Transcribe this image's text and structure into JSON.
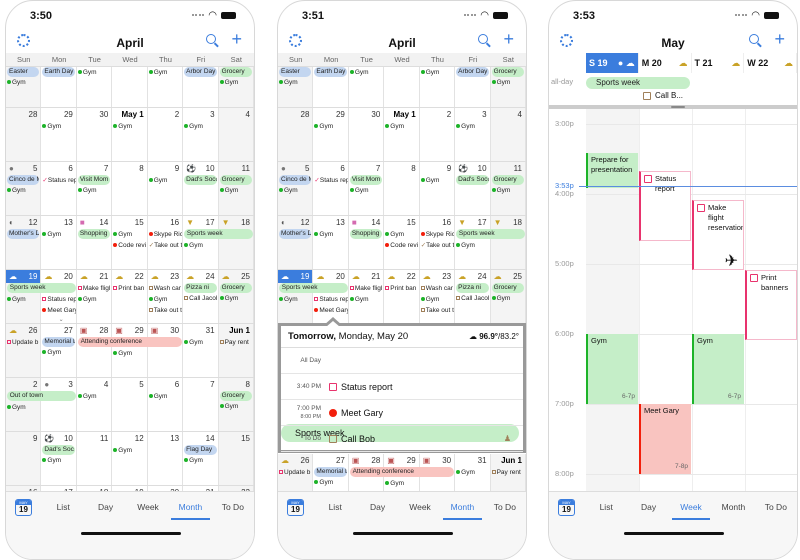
{
  "colors": {
    "accent": "#3b7ddd",
    "green_bar": "#c5eec8",
    "blue_bar": "#c3d6f0",
    "red_bar": "#f9c4c0",
    "green_dot": "#1db329",
    "red_dot": "#f21f0c",
    "pink_task": "#e8336d",
    "brown_task": "#a0805a"
  },
  "phones": [
    {
      "status_time": "3:50",
      "title": "April",
      "selected_tab": "Month"
    },
    {
      "status_time": "3:51",
      "title": "April",
      "selected_tab": "Month"
    },
    {
      "status_time": "3:53",
      "title": "May",
      "selected_tab": "Week"
    }
  ],
  "weekdays": [
    "Sun",
    "Mon",
    "Tue",
    "Wed",
    "Thu",
    "Fri",
    "Sat"
  ],
  "tabs": [
    "List",
    "Day",
    "Week",
    "Month",
    "To Do"
  ],
  "today_badge": {
    "month": "MAY",
    "day": "19"
  },
  "month_weeks": [
    {
      "days": [
        {
          "num": "",
          "events": [
            {
              "t": "bar",
              "c": "blue",
              "text": "Easter"
            },
            {
              "t": "dot",
              "c": "green",
              "text": "Gym"
            }
          ]
        },
        {
          "num": "",
          "events": [
            {
              "t": "bar",
              "c": "blue",
              "text": "Earth Day"
            }
          ]
        },
        {
          "num": "",
          "events": [
            {
              "t": "dot",
              "c": "green",
              "text": "Gym"
            }
          ]
        },
        {
          "num": "",
          "events": []
        },
        {
          "num": "",
          "events": [
            {
              "t": "dot",
              "c": "green",
              "text": "Gym"
            }
          ]
        },
        {
          "num": "",
          "events": [
            {
              "t": "bar",
              "c": "blue",
              "text": "Arbor Day"
            }
          ]
        },
        {
          "num": "",
          "events": [
            {
              "t": "bar",
              "c": "green",
              "text": "Grocery"
            },
            {
              "t": "dot",
              "c": "green",
              "text": "Gym"
            }
          ]
        }
      ],
      "spans": []
    },
    {
      "days": [
        {
          "num": "28",
          "events": []
        },
        {
          "num": "29",
          "events": [
            {
              "t": "dot",
              "c": "green",
              "text": "Gym"
            }
          ]
        },
        {
          "num": "30",
          "events": []
        },
        {
          "num": "May 1",
          "bold": true,
          "events": [
            {
              "t": "dot",
              "c": "green",
              "text": "Gym"
            }
          ]
        },
        {
          "num": "2",
          "events": []
        },
        {
          "num": "3",
          "events": [
            {
              "t": "dot",
              "c": "green",
              "text": "Gym"
            }
          ]
        },
        {
          "num": "4",
          "events": []
        }
      ],
      "spans": []
    },
    {
      "days": [
        {
          "num": "5",
          "icon": "moon-full",
          "events": [
            {
              "t": "bar",
              "c": "blue",
              "text": "Cinco de M"
            },
            {
              "t": "dot",
              "c": "green",
              "text": "Gym"
            }
          ]
        },
        {
          "num": "6",
          "events": [
            {
              "t": "check",
              "c": "pink",
              "text": "Status rep"
            }
          ]
        },
        {
          "num": "7",
          "events": [
            {
              "t": "bar",
              "c": "green",
              "text": "Visit Mom"
            },
            {
              "t": "dot",
              "c": "green",
              "text": "Gym"
            }
          ]
        },
        {
          "num": "8",
          "events": []
        },
        {
          "num": "9",
          "events": [
            {
              "t": "dot",
              "c": "green",
              "text": "Gym"
            }
          ]
        },
        {
          "num": "10",
          "icon": "soccer",
          "events": [
            {
              "t": "bar",
              "c": "green",
              "text": "Dad's Socc"
            }
          ]
        },
        {
          "num": "11",
          "events": [
            {
              "t": "bar",
              "c": "green",
              "text": "Grocery"
            },
            {
              "t": "dot",
              "c": "green",
              "text": "Gym"
            }
          ]
        }
      ],
      "spans": []
    },
    {
      "days": [
        {
          "num": "12",
          "icon": "moon-half",
          "events": [
            {
              "t": "bar",
              "c": "blue",
              "text": "Mother's D"
            }
          ]
        },
        {
          "num": "13",
          "events": [
            {
              "t": "dot",
              "c": "green",
              "text": "Gym"
            }
          ]
        },
        {
          "num": "14",
          "icon": "shopping-bag",
          "events": [
            {
              "t": "bar",
              "c": "green",
              "text": "Shopping"
            }
          ]
        },
        {
          "num": "15",
          "events": [
            {
              "t": "dot",
              "c": "green",
              "text": "Gym"
            },
            {
              "t": "dot",
              "c": "red",
              "text": "Code revi"
            }
          ]
        },
        {
          "num": "16",
          "events": [
            {
              "t": "dot",
              "c": "red",
              "text": "Skype Ric"
            },
            {
              "t": "check",
              "c": "brown",
              "text": "Take out t"
            }
          ]
        },
        {
          "num": "17",
          "icon": "trophy",
          "events": [
            {
              "t": "gap"
            },
            {
              "t": "dot",
              "c": "green",
              "text": "Gym"
            }
          ]
        },
        {
          "num": "18",
          "icon": "trophy",
          "events": [
            {
              "t": "gap"
            }
          ]
        }
      ],
      "spans": [
        {
          "start": 5,
          "days": 2,
          "c": "green",
          "text": "Sports week"
        }
      ]
    },
    {
      "days": [
        {
          "num": "19",
          "today": true,
          "icon": "weather",
          "events": [
            {
              "t": "gap"
            },
            {
              "t": "dot",
              "c": "green",
              "text": "Gym"
            }
          ]
        },
        {
          "num": "20",
          "icon": "weather",
          "chevron": true,
          "events": [
            {
              "t": "gap"
            },
            {
              "t": "box",
              "c": "pink",
              "text": "Status rep"
            },
            {
              "t": "dot",
              "c": "red",
              "text": "Meet Gary"
            }
          ]
        },
        {
          "num": "21",
          "icon": "weather",
          "events": [
            {
              "t": "box",
              "c": "pink",
              "text": "Make fligl"
            },
            {
              "t": "dot",
              "c": "green",
              "text": "Gym"
            }
          ]
        },
        {
          "num": "22",
          "icon": "weather",
          "events": [
            {
              "t": "box",
              "c": "pink",
              "text": "Print ban"
            }
          ]
        },
        {
          "num": "23",
          "icon": "weather",
          "events": [
            {
              "t": "box",
              "c": "brown",
              "text": "Wash car"
            },
            {
              "t": "dot",
              "c": "green",
              "text": "Gym"
            },
            {
              "t": "box",
              "c": "brown",
              "text": "Take out t"
            }
          ]
        },
        {
          "num": "24",
          "icon": "weather",
          "events": [
            {
              "t": "bar",
              "c": "green",
              "text": "Pizza ni"
            },
            {
              "t": "box",
              "c": "brown",
              "text": "Call Jacol"
            }
          ]
        },
        {
          "num": "25",
          "icon": "weather",
          "events": [
            {
              "t": "bar",
              "c": "green",
              "text": "Grocery"
            },
            {
              "t": "dot",
              "c": "green",
              "text": "Gym"
            }
          ]
        }
      ],
      "spans": [
        {
          "start": 0,
          "days": 2,
          "c": "green",
          "text": "Sports week"
        }
      ]
    },
    {
      "days": [
        {
          "num": "26",
          "icon": "weather",
          "events": [
            {
              "t": "box",
              "c": "pink",
              "text": "Update b"
            }
          ]
        },
        {
          "num": "27",
          "events": [
            {
              "t": "bar",
              "c": "blue",
              "text": "Memorial D"
            },
            {
              "t": "dot",
              "c": "green",
              "text": "Gym"
            }
          ]
        },
        {
          "num": "28",
          "icon": "conference",
          "events": [
            {
              "t": "gap"
            }
          ]
        },
        {
          "num": "29",
          "icon": "conference",
          "events": [
            {
              "t": "gap"
            },
            {
              "t": "dot",
              "c": "green",
              "text": "Gym"
            }
          ]
        },
        {
          "num": "30",
          "icon": "conference",
          "events": [
            {
              "t": "gap"
            }
          ]
        },
        {
          "num": "31",
          "events": [
            {
              "t": "dot",
              "c": "green",
              "text": "Gym"
            }
          ]
        },
        {
          "num": "Jun 1",
          "bold": true,
          "events": [
            {
              "t": "box",
              "c": "brown",
              "text": "Pay rent"
            }
          ]
        }
      ],
      "spans": [
        {
          "start": 2,
          "days": 3,
          "c": "red",
          "text": "Attending conference"
        }
      ]
    },
    {
      "days": [
        {
          "num": "2",
          "events": [
            {
              "t": "gap"
            },
            {
              "t": "dot",
              "c": "green",
              "text": "Gym"
            }
          ]
        },
        {
          "num": "3",
          "icon": "moon-new",
          "events": [
            {
              "t": "gap"
            }
          ]
        },
        {
          "num": "4",
          "events": [
            {
              "t": "dot",
              "c": "green",
              "text": "Gym"
            }
          ]
        },
        {
          "num": "5",
          "events": []
        },
        {
          "num": "6",
          "events": [
            {
              "t": "dot",
              "c": "green",
              "text": "Gym"
            }
          ]
        },
        {
          "num": "7",
          "events": []
        },
        {
          "num": "8",
          "events": [
            {
              "t": "bar",
              "c": "green",
              "text": "Grocery"
            },
            {
              "t": "dot",
              "c": "green",
              "text": "Gym"
            }
          ]
        }
      ],
      "spans": [
        {
          "start": 0,
          "days": 2,
          "c": "green",
          "text": "Out of town"
        }
      ]
    },
    {
      "days": [
        {
          "num": "9",
          "events": []
        },
        {
          "num": "10",
          "icon": "soccer",
          "events": [
            {
              "t": "bar",
              "c": "green",
              "text": "Dad's Soc"
            },
            {
              "t": "dot",
              "c": "green",
              "text": "Gym"
            }
          ]
        },
        {
          "num": "11",
          "events": []
        },
        {
          "num": "12",
          "events": [
            {
              "t": "dot",
              "c": "green",
              "text": "Gym"
            }
          ]
        },
        {
          "num": "13",
          "events": []
        },
        {
          "num": "14",
          "events": [
            {
              "t": "bar",
              "c": "blue",
              "text": "Flag Day"
            },
            {
              "t": "dot",
              "c": "green",
              "text": "Gym"
            }
          ]
        },
        {
          "num": "15",
          "events": []
        }
      ],
      "spans": []
    },
    {
      "days": [
        {
          "num": "16",
          "events": []
        },
        {
          "num": "17",
          "icon": "moon-empty",
          "events": []
        },
        {
          "num": "18",
          "events": []
        },
        {
          "num": "19",
          "events": []
        },
        {
          "num": "20",
          "events": []
        },
        {
          "num": "21",
          "events": []
        },
        {
          "num": "22",
          "events": []
        }
      ],
      "spans": []
    }
  ],
  "popup": {
    "title_bold": "Tomorrow,",
    "title_rest": " Monday, May 20",
    "weather_high": "96.9°",
    "weather_low": "/83.2°",
    "rows": [
      {
        "label": "All Day",
        "label2": "",
        "text": "Sports week",
        "kind": "allday"
      },
      {
        "label": "3:40 PM",
        "label2": "",
        "text": "Status report",
        "kind": "task-pink"
      },
      {
        "label": "7:00 PM",
        "label2": "8:00 PM",
        "text": "Meet Gary",
        "kind": "event-red"
      },
      {
        "label": "To Do",
        "label2": "",
        "text": "Call Bob",
        "kind": "task-brown"
      }
    ]
  },
  "week_view": {
    "days": [
      {
        "label": "S 19",
        "today": true
      },
      {
        "label": "M 20"
      },
      {
        "label": "T 21"
      },
      {
        "label": "W 22"
      }
    ],
    "allday_label": "all-day",
    "allday_span": {
      "text": "Sports week",
      "start": 0,
      "days": 2
    },
    "allday_todo": {
      "text": "Call B...",
      "day": 1
    },
    "hours": [
      "3:00p",
      "4:00p",
      "5:00p",
      "6:00p",
      "7:00p",
      "8:00p"
    ],
    "now_label": "3:53p",
    "now": "15:53",
    "events": [
      {
        "day": 0,
        "start": "15:25",
        "end": "15:55",
        "text": "Prepare for presentation",
        "kind": "event-green"
      },
      {
        "day": 1,
        "start": "15:40",
        "end": "16:40",
        "text": "Status report",
        "kind": "task"
      },
      {
        "day": 2,
        "start": "16:05",
        "end": "17:05",
        "text": "Make flight reservations",
        "kind": "task",
        "icon": "airplane"
      },
      {
        "day": 3,
        "start": "17:05",
        "end": "18:05",
        "text": "Print banners",
        "kind": "task"
      },
      {
        "day": 0,
        "start": "18:00",
        "end": "19:00",
        "text": "Gym",
        "kind": "event-green",
        "dur": "6-7p"
      },
      {
        "day": 2,
        "start": "18:00",
        "end": "19:00",
        "text": "Gym",
        "kind": "event-green",
        "dur": "6-7p"
      },
      {
        "day": 1,
        "start": "19:00",
        "end": "20:00",
        "text": "Meet Gary",
        "kind": "event-red",
        "dur": "7-8p"
      }
    ]
  }
}
